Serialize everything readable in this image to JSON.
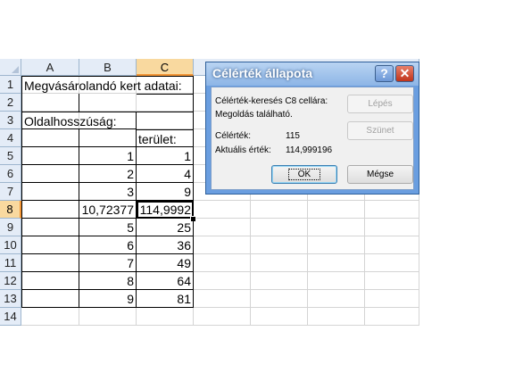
{
  "sheet": {
    "columns": [
      "A",
      "B",
      "C"
    ],
    "rows": [
      "1",
      "2",
      "3",
      "4",
      "5",
      "6",
      "7",
      "8",
      "9",
      "10",
      "11",
      "12",
      "13",
      "14"
    ],
    "selected_row": "8",
    "selected_col": "C",
    "cells": {
      "A1": "Megvásárolandó kert adatai:",
      "A3": "Oldalhosszúság:",
      "C4": "terület:",
      "B5": "1",
      "C5": "1",
      "B6": "2",
      "C6": "4",
      "B7": "3",
      "C7": "9",
      "B8": "10,72377",
      "C8": "114,9992",
      "B9": "5",
      "C9": "25",
      "B10": "6",
      "C10": "36",
      "B11": "7",
      "C11": "49",
      "B12": "8",
      "C12": "64",
      "B13": "9",
      "C13": "81"
    }
  },
  "dialog": {
    "title": "Célérték állapota",
    "help_glyph": "?",
    "close_glyph": "✕",
    "status_line1": "Célérték-keresés C8 cellára:",
    "status_line2": "Megoldás található.",
    "target_label": "Célérték:",
    "target_value": "115",
    "current_label": "Aktuális érték:",
    "current_value": "114,999196",
    "step_button": "Lépés",
    "pause_button": "Szünet",
    "ok_button": "OK",
    "cancel_button": "Mégse"
  },
  "colors": {
    "header_bg": "#e4ecf7",
    "selected_header_bg": "#f9d99f",
    "dialog_frame": "#6a9ee0",
    "close_button": "#c0331a"
  }
}
